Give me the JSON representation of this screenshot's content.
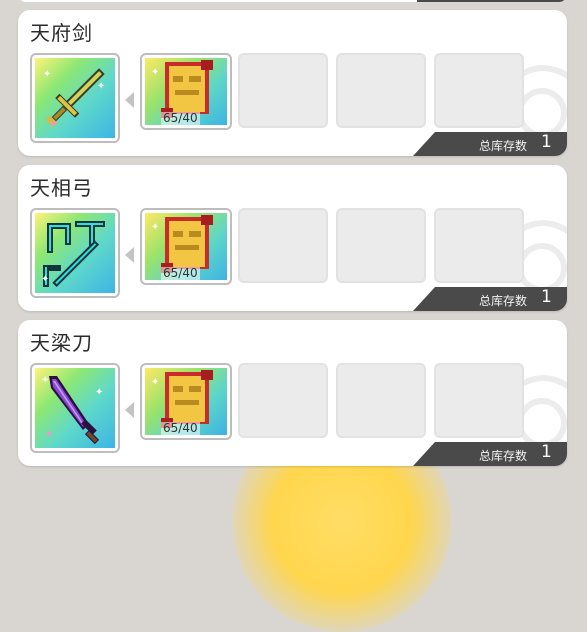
{
  "colors": {
    "card_bg": "#ffffff",
    "stock_bar": "#4a4a4a",
    "rarity_gradient": [
      "#fff27a",
      "#8de873",
      "#5fd8c9",
      "#3cb5e6"
    ],
    "empty_slot": "#ebebeb"
  },
  "items": [
    {
      "name": "天府剑",
      "weapon_icon": "sword-icon",
      "material_icon": "scroll-tome-icon",
      "material_count": "65/40",
      "empty_slots": 3,
      "stock_label": "总库存数",
      "stock_value": "1"
    },
    {
      "name": "天相弓",
      "weapon_icon": "bow-icon",
      "material_icon": "scroll-tome-icon",
      "material_count": "65/40",
      "empty_slots": 3,
      "stock_label": "总库存数",
      "stock_value": "1"
    },
    {
      "name": "天梁刀",
      "weapon_icon": "blade-icon",
      "material_icon": "scroll-tome-icon",
      "material_count": "65/40",
      "empty_slots": 3,
      "stock_label": "总库存数",
      "stock_value": "1"
    }
  ]
}
